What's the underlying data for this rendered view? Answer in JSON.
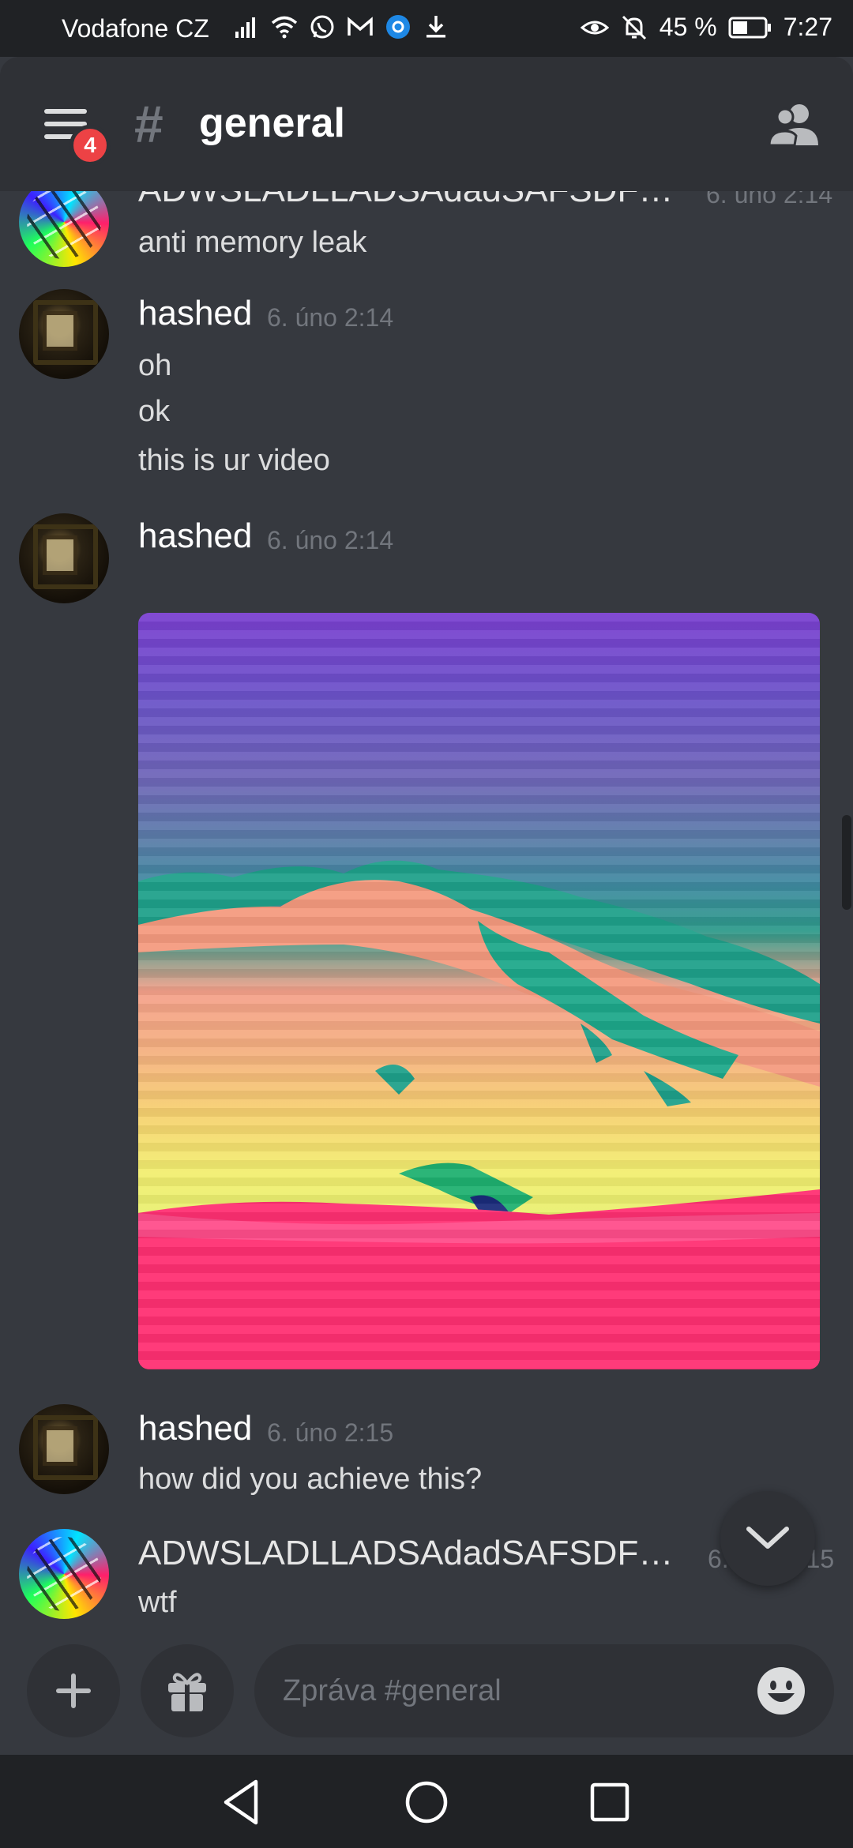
{
  "status_bar": {
    "carrier": "Vodafone CZ",
    "battery": "45 %",
    "time": "7:27",
    "icons": [
      "signal-icon",
      "wifi-icon",
      "whatsapp-icon",
      "gmail-icon",
      "app-icon",
      "download-icon",
      "eye-icon",
      "bell-off-icon",
      "battery-icon"
    ]
  },
  "header": {
    "menu_badge": "4",
    "channel_prefix": "#",
    "channel_name": "general"
  },
  "messages": [
    {
      "author": "ADWSLADLLADSAdadSAFSDF…",
      "timestamp": "6. úno 2:14",
      "lines": [
        "anti memory leak"
      ],
      "avatar": "glitch"
    },
    {
      "author": "hashed",
      "timestamp": "6. úno 2:14",
      "lines": [
        "oh",
        "ok",
        "this is ur video"
      ],
      "avatar": "hashed"
    },
    {
      "author": "hashed",
      "timestamp": "6. úno 2:14",
      "lines": [],
      "attachment": "video",
      "avatar": "hashed"
    },
    {
      "author": "hashed",
      "timestamp": "6. úno 2:15",
      "lines": [
        "how did you achieve this?"
      ],
      "avatar": "hashed"
    },
    {
      "author": "ADWSLADLLADSAdadSAFSDF…",
      "timestamp": "6. úno 2:15",
      "lines": [
        "wtf"
      ],
      "avatar": "glitch"
    }
  ],
  "composer": {
    "placeholder": "Zpráva #general"
  },
  "colors": {
    "background": "#36393f",
    "header": "#2f3136",
    "status_bar": "#202225",
    "badge": "#ed4245"
  }
}
